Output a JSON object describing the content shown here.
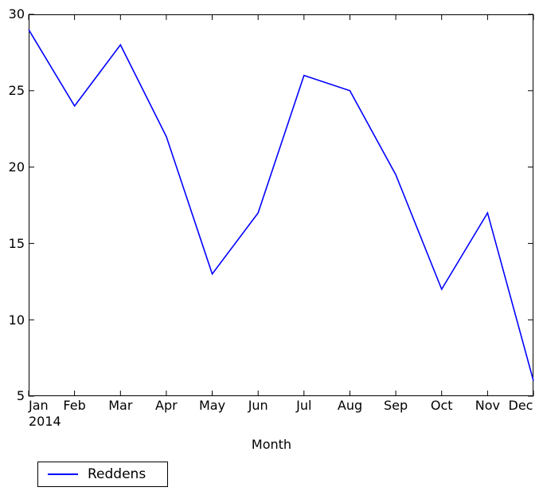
{
  "chart_data": {
    "type": "line",
    "title": "",
    "xlabel": "Month",
    "ylabel": "",
    "categories": [
      "Jan",
      "Feb",
      "Mar",
      "Apr",
      "May",
      "Jun",
      "Jul",
      "Aug",
      "Sep",
      "Oct",
      "Nov",
      "Dec"
    ],
    "x_sublabel": "2014",
    "series": [
      {
        "name": "Reddens",
        "color": "#0000ff",
        "values": [
          29,
          24,
          28,
          22,
          13,
          17,
          26,
          25,
          19.5,
          12,
          17,
          6
        ]
      }
    ],
    "ylim": [
      5,
      30
    ],
    "yticks": [
      5,
      10,
      15,
      20,
      25,
      30
    ],
    "ytick_labels": [
      "5",
      "10",
      "15",
      "20",
      "25",
      "30"
    ],
    "grid": false,
    "legend_position": "below-left"
  },
  "axes": {
    "x_label": "Month"
  },
  "legend": {
    "entries": [
      {
        "label": "Reddens",
        "color": "#0000ff"
      }
    ]
  }
}
